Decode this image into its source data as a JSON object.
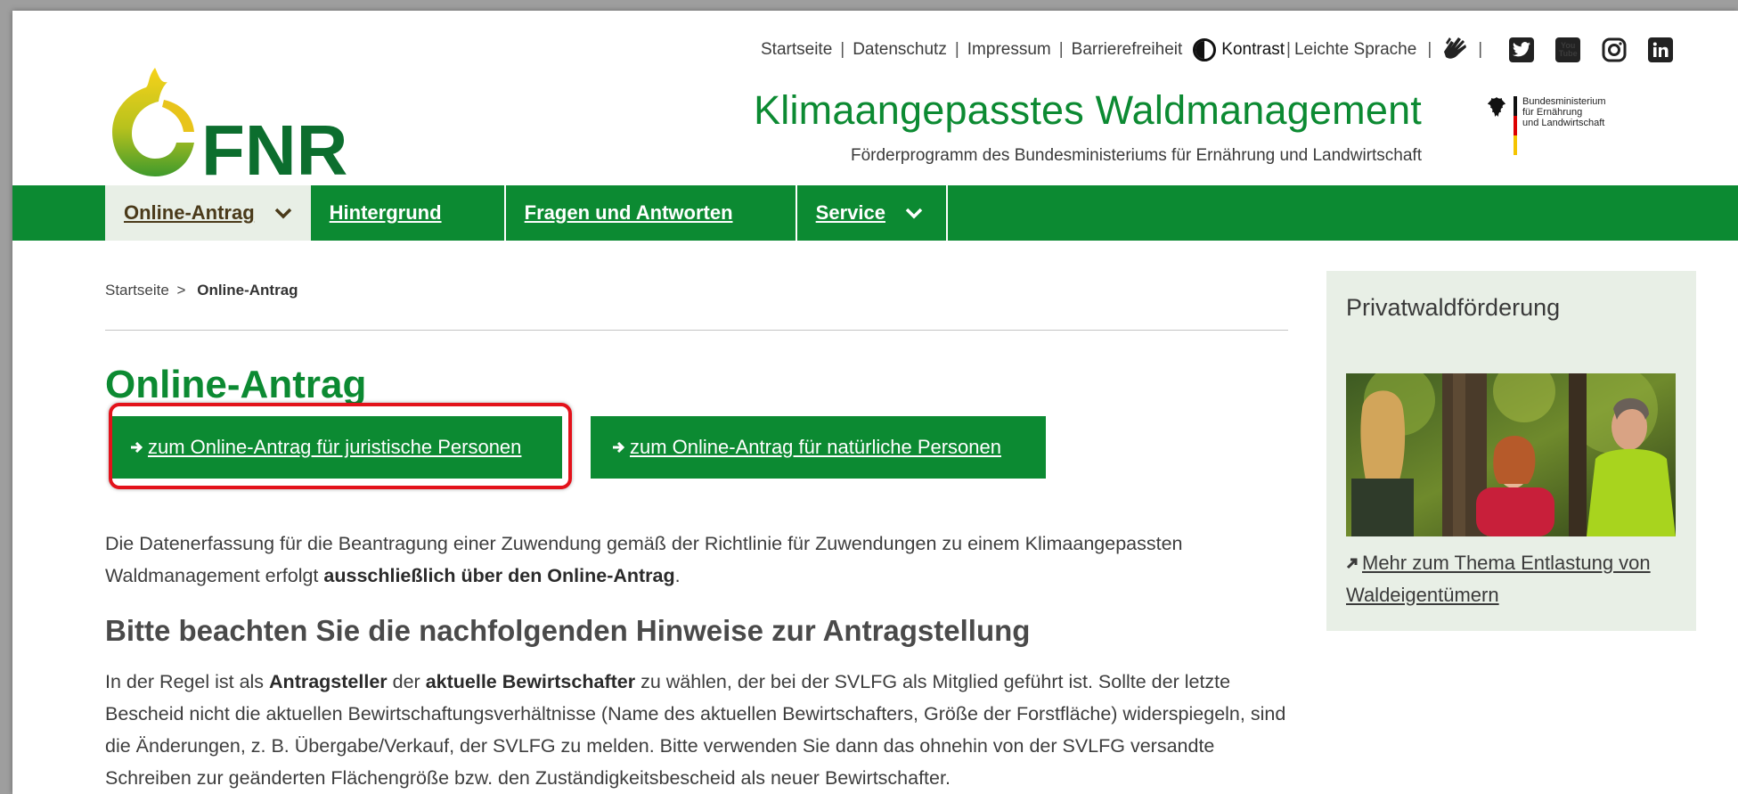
{
  "topbar": {
    "links": [
      "Startseite",
      "Datenschutz",
      "Impressum",
      "Barrierefreiheit"
    ],
    "kontrast": "Kontrast",
    "leichte_sprache": "Leichte Sprache",
    "youtube_line1": "You",
    "youtube_line2": "Tube",
    "social_icons": [
      "sign-language-icon",
      "twitter-icon",
      "youtube-icon",
      "instagram-icon",
      "linkedin-icon"
    ]
  },
  "logo": {
    "text": "FNR"
  },
  "header": {
    "title": "Klimaangepasstes Waldmanagement",
    "subtitle": "Förderprogramm des Bundesministeriums für Ernährung und Landwirtschaft",
    "ministry": [
      "Bundesministerium",
      "für Ernährung",
      "und Landwirtschaft"
    ]
  },
  "nav": {
    "items": [
      {
        "label": "Online-Antrag",
        "dropdown": true,
        "active": true
      },
      {
        "label": "Hintergrund",
        "dropdown": false
      },
      {
        "label": "Fragen und Antworten",
        "dropdown": false
      },
      {
        "label": "Service",
        "dropdown": true
      }
    ]
  },
  "breadcrumb": {
    "home": "Startseite",
    "separator": ">",
    "current": "Online-Antrag"
  },
  "main": {
    "title": "Online-Antrag",
    "button_juristisch": "zum Online-Antrag für juristische Personen",
    "button_natuerlich": "zum Online-Antrag für natürliche Personen",
    "para1_a": "Die Datenerfassung für die Beantragung einer Zuwendung gemäß der Richtlinie für Zuwendungen zu einem Klimaangepassten Waldmanagement erfolgt ",
    "para1_b": "ausschließlich über den Online-Antrag",
    "para1_c": ".",
    "heading": "Bitte beachten Sie die nachfolgenden Hinweise zur Antragstellung",
    "para2_a": "In der Regel ist als ",
    "para2_b": "Antragsteller",
    "para2_c": " der ",
    "para2_d": "aktuelle Bewirtschafter",
    "para2_e": " zu wählen, der bei der SVLFG als Mitglied geführt ist. Sollte der letzte Bescheid nicht die aktuellen Bewirtschaftungsverhältnisse (Name des aktuellen Bewirtschafters, Größe der Forstfläche) widerspiegeln, sind die Änderungen, z. B. Übergabe/Verkauf, der SVLFG zu melden. Bitte verwenden Sie dann das ohnehin von der SVLFG versandte Schreiben zur geänderten Flächengröße bzw. den Zuständigkeitsbescheid als neuer Bewirtschafter."
  },
  "sidebar": {
    "title": "Privatwaldförderung",
    "link": "Mehr zum Thema Entlastung von Waldeigentümern"
  },
  "colors": {
    "brand_green": "#0c8a32",
    "highlight_red": "#e3121b",
    "sidebar_bg": "#e8efe6"
  }
}
